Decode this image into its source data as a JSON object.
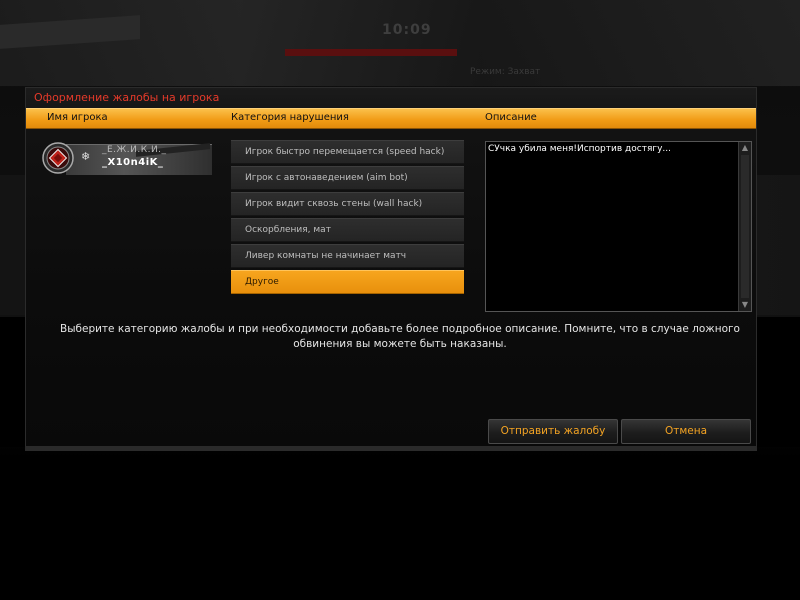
{
  "background": {
    "timer": "10:09",
    "hint": "Режим: Захват"
  },
  "dialog": {
    "title": "Оформление жалобы на игрока",
    "columns": {
      "player_name": "Имя игрока",
      "category": "Категория нарушения",
      "description": "Описание"
    },
    "player": {
      "clan": "_Е.Ж.И.К.И._",
      "nickname": "_X10n4iK_",
      "rank_badge_icon": "rank-badge-icon",
      "status_icon": "snowflake-icon"
    },
    "categories": [
      {
        "label": "Игрок быстро перемещается (speed hack)",
        "selected": false
      },
      {
        "label": "Игрок с автонаведением (aim bot)",
        "selected": false
      },
      {
        "label": "Игрок видит сквозь стены (wall hack)",
        "selected": false
      },
      {
        "label": "Оскорбления, мат",
        "selected": false
      },
      {
        "label": "Ливер комнаты не начинает матч",
        "selected": false
      },
      {
        "label": "Другое",
        "selected": true
      }
    ],
    "description_value": "СУчка убила меня!Испортив достягу...",
    "notice": "Выберите категорию жалобы и при необходимости добавьте более подробное описание. Помните, что в случае ложного обвинения вы можете быть наказаны.",
    "buttons": {
      "send": "Отправить жалобу",
      "cancel": "Отмена"
    }
  },
  "colors": {
    "accent_orange": "#f09a14",
    "title_red": "#e53a2a",
    "button_text": "#f3a323"
  }
}
